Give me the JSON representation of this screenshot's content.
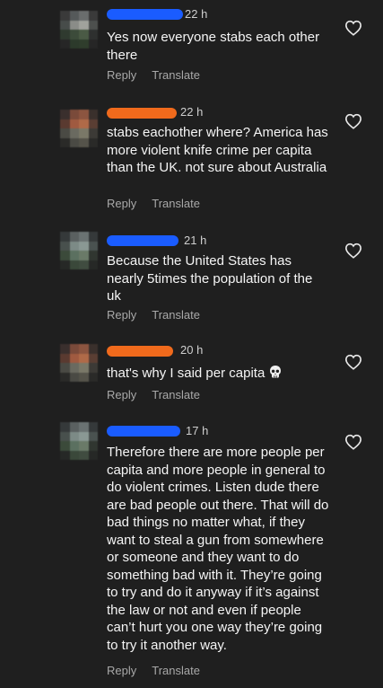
{
  "comments": [
    {
      "time": "22 h",
      "text": "Yes now everyone stabs each other there",
      "reply": "Reply",
      "translate": "Translate",
      "redact_color": "#1a5cff"
    },
    {
      "time": "22 h",
      "text": "stabs eachother where? America has more violent knife crime per capita than the UK. not sure about Australia",
      "reply": "Reply",
      "translate": "Translate",
      "redact_color": "#f06a1c"
    },
    {
      "time": "21 h",
      "text": "Because the United States has nearly 5times the population of the uk",
      "reply": "Reply",
      "translate": "Translate",
      "redact_color": "#1a5cff"
    },
    {
      "time": "20 h",
      "text": "that's why I said per capita",
      "emoji": "skull",
      "reply": "Reply",
      "translate": "Translate",
      "redact_color": "#f06a1c"
    },
    {
      "time": "17 h",
      "text": "Therefore there are more people per capita and more people in general to do violent crimes. Listen dude there are bad people out there. That will do bad things no matter what, if they want to steal a gun from somewhere or someone and they want to do something bad with it. They’re going to try and do it anyway if it’s against the law or not and even if people can’t hurt you one way they’re going to try it another way.",
      "reply": "Reply",
      "translate": "Translate",
      "redact_color": "#1a5cff"
    }
  ],
  "icons": {
    "like": "heart-outline-icon",
    "emoji": "skull-emoji-icon"
  },
  "colors": {
    "background": "#1f1f1f",
    "secondary_text": "#a8a8a8"
  }
}
